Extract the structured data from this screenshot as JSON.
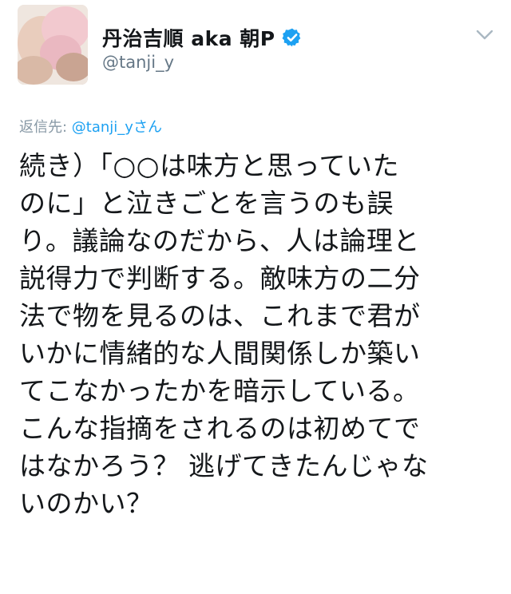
{
  "author": {
    "name": "丹治吉順 aka 朝P",
    "handle": "@tanji_y",
    "verified_icon": "verified-badge-icon",
    "verified_color": "#1da1f2"
  },
  "reply": {
    "prefix": "返信先: ",
    "mention": "@tanji_y",
    "suffix": "さん"
  },
  "tweet": {
    "text": "続き）「○○は味方と思っていた\nのに」と泣きごとを言うのも誤\nり。議論なのだから、人は論理と\n説得力で判断する。敵味方の二分\n法で物を見るのは、これまで君が\nいかに情緒的な人間関係しか築い\nてこなかったかを暗示している。\nこんな指摘をされるのは初めてで\nはなかろう？ 逃げてきたんじゃな\nいのかい？"
  },
  "menu": {
    "icon": "chevron-down-icon"
  }
}
